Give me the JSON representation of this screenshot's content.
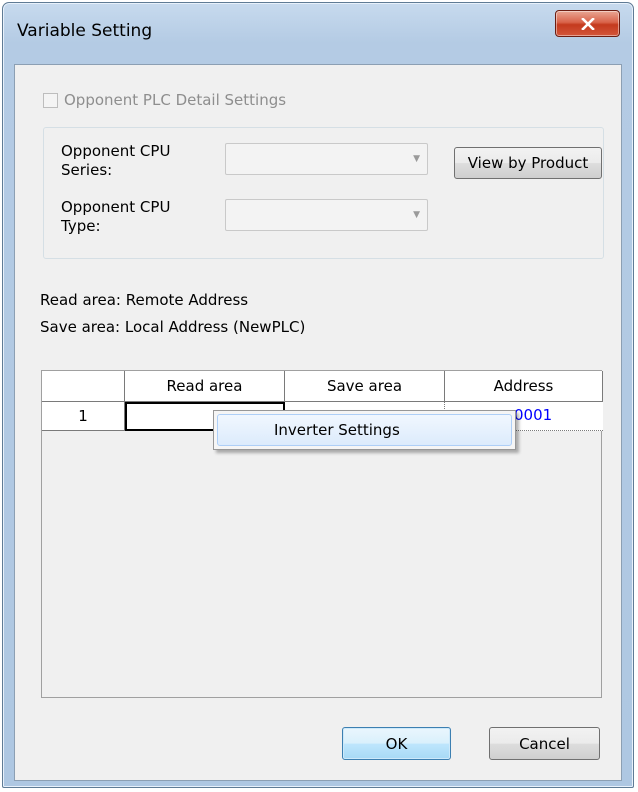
{
  "window": {
    "title": "Variable Setting",
    "close_icon": "close-icon"
  },
  "opponent": {
    "checkbox_label": "Opponent PLC Detail Settings",
    "checked": false,
    "cpu_series_label": "Opponent CPU\nSeries:",
    "cpu_series_value": "",
    "cpu_type_label": "Opponent CPU\nType:",
    "cpu_type_value": "",
    "view_by_product_label": "View by Product"
  },
  "info": {
    "read_area": "Read area: Remote Address",
    "save_area": "Save area: Local Address (NewPLC)"
  },
  "table": {
    "columns": [
      "",
      "Read area",
      "Save area",
      "Address"
    ],
    "rows": [
      {
        "index": "1",
        "read_area": "",
        "save_area": "",
        "address": "0001"
      }
    ]
  },
  "context_menu": {
    "items": [
      "Inverter Settings"
    ]
  },
  "buttons": {
    "ok": "OK",
    "cancel": "Cancel"
  },
  "colors": {
    "address_text": "#0000ff",
    "close_button": "#c43a1e"
  }
}
